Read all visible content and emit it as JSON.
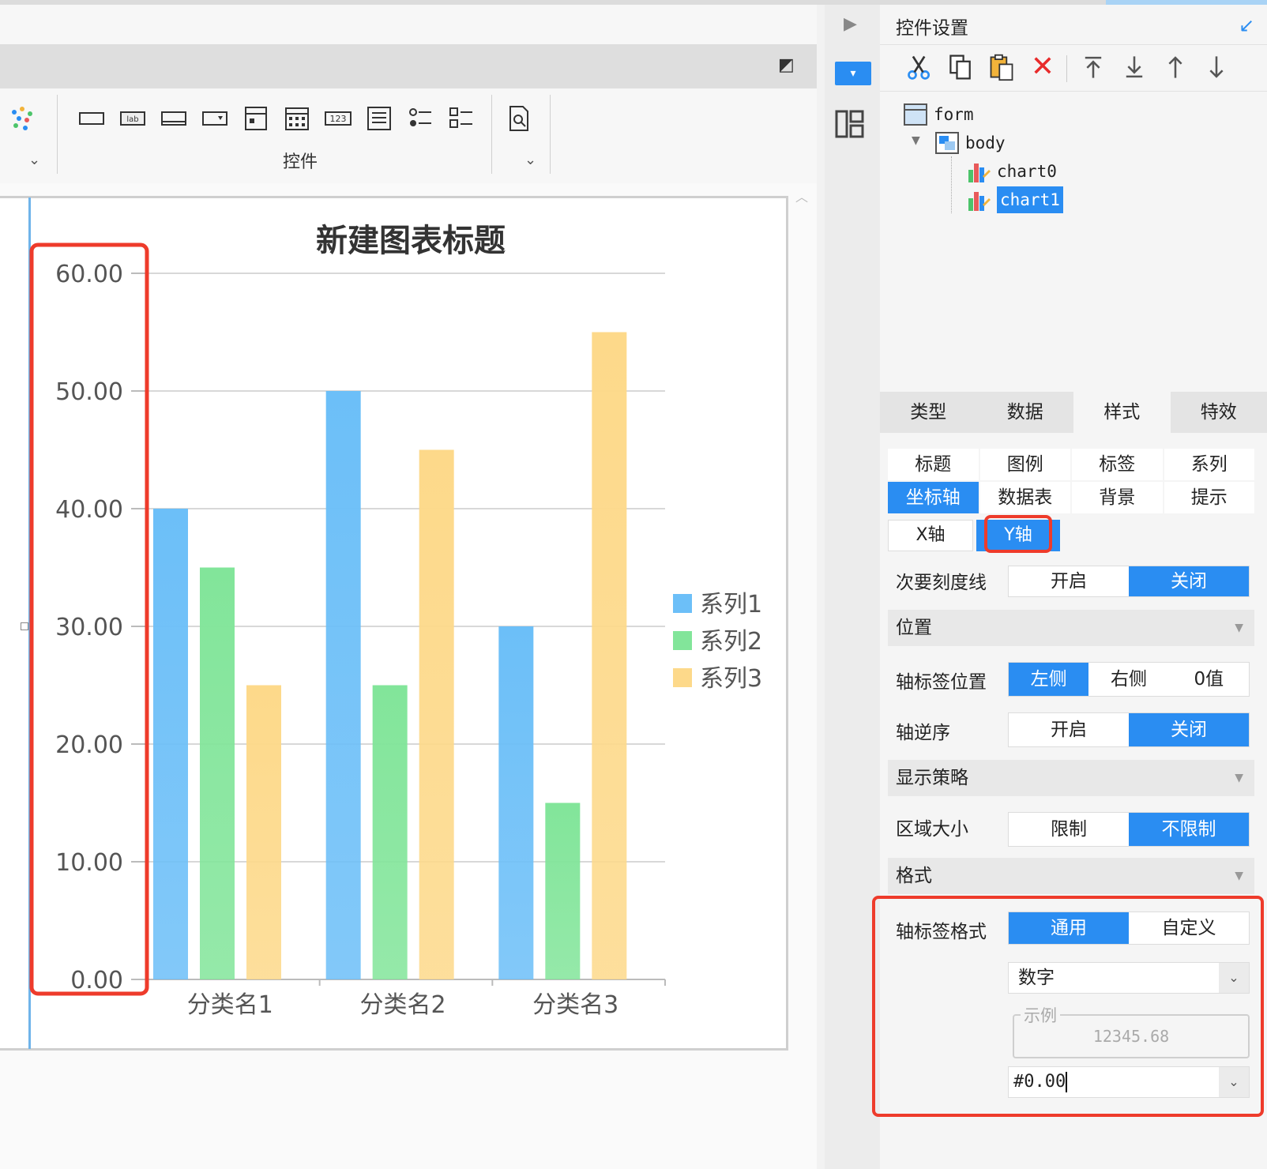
{
  "ribbon": {
    "group_label": "控件"
  },
  "panel": {
    "title": "控件设置",
    "tree": {
      "root": "form",
      "body": "body",
      "chart0": "chart0",
      "chart1": "chart1"
    },
    "tabs": [
      "类型",
      "数据",
      "样式",
      "特效"
    ],
    "subtabs": [
      "标题",
      "图例",
      "标签",
      "系列",
      "坐标轴",
      "数据表",
      "背景",
      "提示"
    ],
    "axis_tabs": [
      "X轴",
      "Y轴"
    ],
    "minor_tick": {
      "label": "次要刻度线",
      "on": "开启",
      "off": "关闭"
    },
    "section_position": "位置",
    "label_position": {
      "label": "轴标签位置",
      "left": "左侧",
      "right": "右侧",
      "zero": "0值"
    },
    "axis_reverse": {
      "label": "轴逆序",
      "on": "开启",
      "off": "关闭"
    },
    "section_strategy": "显示策略",
    "area_size": {
      "label": "区域大小",
      "limit": "限制",
      "unlimited": "不限制"
    },
    "section_format": "格式",
    "label_format": {
      "label": "轴标签格式",
      "general": "通用",
      "custom": "自定义"
    },
    "number_type": "数字",
    "example_legend": "示例",
    "example_value": "12345.68",
    "format_value": "#0.00",
    "accent_color": "#2a8df2",
    "highlight_color": "#ee3b2b"
  },
  "chart_data": {
    "type": "bar",
    "title": "新建图表标题",
    "categories": [
      "分类名1",
      "分类名2",
      "分类名3"
    ],
    "series": [
      {
        "name": "系列1",
        "values": [
          40,
          50,
          30
        ],
        "color": "#6cbff8"
      },
      {
        "name": "系列2",
        "values": [
          35,
          25,
          15
        ],
        "color": "#82e59a"
      },
      {
        "name": "系列3",
        "values": [
          25,
          45,
          55
        ],
        "color": "#fdd98a"
      }
    ],
    "y_ticks": [
      "0.00",
      "10.00",
      "20.00",
      "30.00",
      "40.00",
      "50.00",
      "60.00"
    ],
    "ylim": [
      0,
      60
    ],
    "grid": true,
    "legend": "right"
  }
}
